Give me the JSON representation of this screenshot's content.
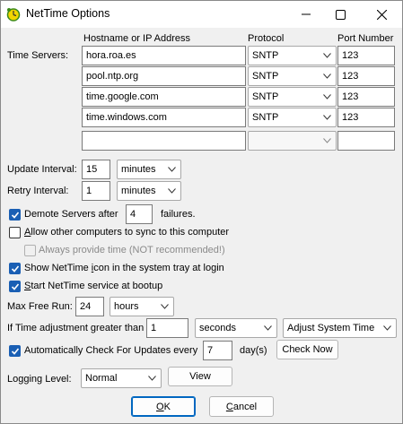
{
  "window": {
    "title": "NetTime Options",
    "controls": {
      "minimize": "minimize",
      "maximize": "maximize",
      "close": "close"
    }
  },
  "servers": {
    "section_label": "Time Servers:",
    "columns": {
      "host": "Hostname or IP Address",
      "protocol": "Protocol",
      "port": "Port Number"
    },
    "rows": [
      {
        "host": "hora.roa.es",
        "protocol": "SNTP",
        "port": "123"
      },
      {
        "host": "pool.ntp.org",
        "protocol": "SNTP",
        "port": "123"
      },
      {
        "host": "time.google.com",
        "protocol": "SNTP",
        "port": "123"
      },
      {
        "host": "time.windows.com",
        "protocol": "SNTP",
        "port": "123"
      },
      {
        "host": "",
        "protocol": "",
        "port": ""
      }
    ]
  },
  "update_interval": {
    "label": "Update Interval:",
    "value": "15",
    "unit": "minutes"
  },
  "retry_interval": {
    "label": "Retry Interval:",
    "value": "1",
    "unit": "minutes"
  },
  "demote": {
    "label_before": "Demote Servers after",
    "value": "4",
    "label_after": "failures.",
    "checked": true
  },
  "allow_sync": {
    "label_a": "A",
    "label_rest": "llow other computers to sync to this computer",
    "checked": false
  },
  "always_provide": {
    "label": "Always provide time (NOT recommended!)",
    "checked": false,
    "enabled": false
  },
  "tray_icon": {
    "label_a": "Show NetTime ",
    "label_u": "i",
    "label_b": "con in the system tray at login",
    "checked": true
  },
  "start_service": {
    "label_u": "S",
    "label_rest": "tart NetTime service at bootup",
    "checked": true
  },
  "max_free_run": {
    "label": "Max Free Run:",
    "value": "24",
    "unit": "hours"
  },
  "time_adjust": {
    "label": "If Time adjustment greater than",
    "value": "1",
    "unit": "seconds",
    "action": "Adjust System Time"
  },
  "auto_update": {
    "label": "Automatically Check For Updates every",
    "value": "7",
    "unit_label": "day(s)",
    "button": "Check Now",
    "checked": true
  },
  "logging": {
    "label": "Logging Level:",
    "value": "Normal",
    "view_button": "View"
  },
  "footer": {
    "ok_u": "O",
    "ok_rest": "K",
    "cancel_u": "C",
    "cancel_rest": "ancel"
  },
  "colors": {
    "accent": "#1a5fb4",
    "default_button": "#0067c0",
    "window_bg": "#f0f0f0"
  }
}
